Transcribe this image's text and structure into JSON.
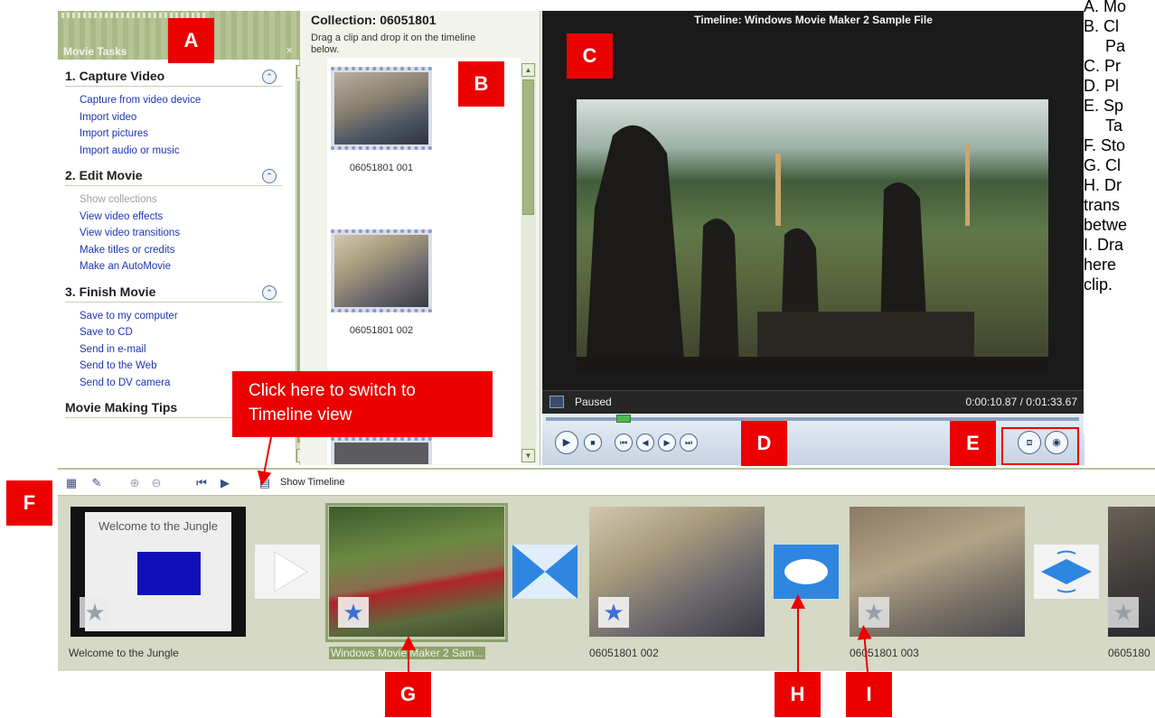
{
  "task_pane": {
    "title": "Movie Tasks",
    "close": "×",
    "groups": [
      {
        "heading": "1. Capture Video",
        "toggle": "⌃",
        "links": [
          "Capture from video device",
          "Import video",
          "Import pictures",
          "Import audio or music"
        ]
      },
      {
        "heading": "2. Edit Movie",
        "toggle": "⌃",
        "links": [
          "Show collections",
          "View video effects",
          "View video transitions",
          "Make titles or credits",
          "Make an AutoMovie"
        ]
      },
      {
        "heading": "3. Finish Movie",
        "toggle": "⌃",
        "links": [
          "Save to my computer",
          "Save to CD",
          "Send in e-mail",
          "Send to the Web",
          "Send to DV camera"
        ]
      },
      {
        "heading": "Movie Making Tips",
        "toggle": "⌃",
        "links": []
      }
    ]
  },
  "collection": {
    "title": "Collection: 06051801",
    "hint": "Drag a clip and drop it on the timeline below.",
    "clips": [
      {
        "caption": "06051801 001"
      },
      {
        "caption": "06051801 002"
      }
    ]
  },
  "monitor": {
    "title": "Timeline: Windows Movie Maker 2 Sample File",
    "status": "Paused",
    "time": "0:00:10.87 / 0:01:33.67"
  },
  "toolbar": {
    "show_timeline": "Show Timeline"
  },
  "storyboard": {
    "clips": [
      {
        "caption": "Welcome to the Jungle",
        "title_card": "Welcome to the Jungle"
      },
      {
        "caption": "Windows Movie Maker 2 Sam..."
      },
      {
        "caption": "06051801 002"
      },
      {
        "caption": "06051801 003"
      },
      {
        "caption": "0605180"
      }
    ]
  },
  "callouts": {
    "switch_view": "Click here to switch to Timeline view",
    "labels": [
      "A",
      "B",
      "C",
      "D",
      "E",
      "F",
      "G",
      "H",
      "I"
    ]
  },
  "legend": {
    "lines": [
      "A. Mo",
      "B. Cl",
      "Pa",
      "C. Pr",
      "D. Pl",
      "E. Sp",
      "Ta",
      "F. Sto",
      "G. Cl",
      "H. Dr",
      "trans",
      "betwe",
      "I. Dra",
      "here",
      "clip."
    ]
  },
  "colors": {
    "accent_red": "#ec0000",
    "pane_green": "#a9b887",
    "link_blue": "#1c35b3",
    "selection_green": "#8ea26b"
  }
}
